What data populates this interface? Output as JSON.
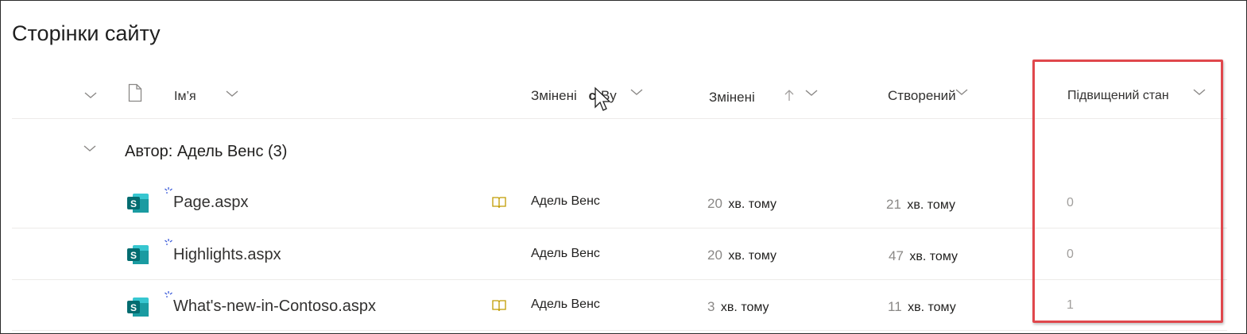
{
  "page": {
    "title": "Сторінки сайту"
  },
  "columns": {
    "name": "Ім’я",
    "modified_by_part1": "Змінені",
    "modified_by_part2": "By",
    "modified": "Змінені",
    "created": "Створений",
    "promoted_state": "Підвищений стан"
  },
  "group": {
    "label": "Автор: Адель Венс (3)"
  },
  "rows": [
    {
      "name": "Page.aspx",
      "modified_by": "Адель Венс",
      "modified_num": "20",
      "modified_unit": "хв. тому",
      "created_num": "21",
      "created_unit": "хв. тому",
      "promoted": "0",
      "book_icon": true
    },
    {
      "name": "Highlights.aspx",
      "modified_by": "Адель Венс",
      "modified_num": "20",
      "modified_unit": "хв. тому",
      "created_num": "47",
      "created_unit": "хв. тому",
      "promoted": "0",
      "book_icon": false
    },
    {
      "name": "What's-new-in-Contoso.aspx",
      "modified_by": "Адель Венс",
      "modified_num": "3",
      "modified_unit": "хв. тому",
      "created_num": "11",
      "created_unit": "хв. тому",
      "promoted": "1",
      "book_icon": true
    }
  ],
  "icons": {
    "file_type": "sharepoint-page-icon",
    "new_item": "new-item-sparkle-icon",
    "book": "book-icon",
    "sort": "sort-ascending-arrow-icon",
    "chevron": "chevron-down-icon",
    "cursor": "mouse-pointer-icon"
  },
  "colors": {
    "sharepoint_dark": "#036c70",
    "sharepoint_mid": "#1a9ba1",
    "sharepoint_light": "#37c6d0",
    "highlight_border": "#e0474c",
    "new_mark": "#3b5bd9",
    "book": "#c19c00"
  }
}
